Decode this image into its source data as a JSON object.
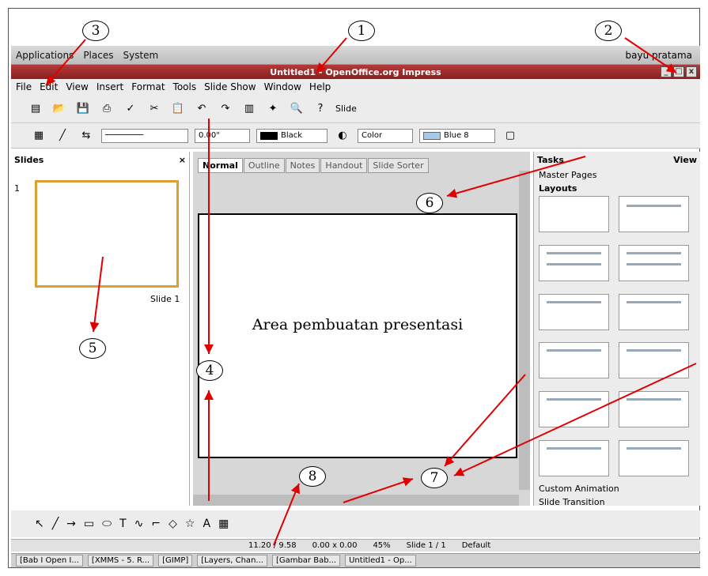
{
  "topbar": {
    "apps": "Applications",
    "places": "Places",
    "system": "System",
    "user": "bayu pratama"
  },
  "window": {
    "title": "Untitled1 - OpenOffice.org Impress"
  },
  "menu": [
    "File",
    "Edit",
    "View",
    "Insert",
    "Format",
    "Tools",
    "Slide Show",
    "Window",
    "Help"
  ],
  "toolbar2": {
    "linewidth": "0.00\"",
    "color": "Black",
    "fillmode": "Color",
    "fillcolor": "Blue 8"
  },
  "slides_panel": {
    "title": "Slides",
    "slide_num": "1",
    "slide_label": "Slide 1"
  },
  "editor": {
    "tabs": [
      "Normal",
      "Outline",
      "Notes",
      "Handout",
      "Slide Sorter"
    ],
    "slide_text": "Area pembuatan presentasi"
  },
  "tasks": {
    "title": "Tasks",
    "view": "View",
    "master": "Master Pages",
    "layouts": "Layouts",
    "animation": "Custom Animation",
    "transition": "Slide Transition"
  },
  "status": {
    "pos": "11.20 / 9.58",
    "size": "0.00 x 0.00",
    "zoom": "45%",
    "slide": "Slide 1 / 1",
    "style": "Default"
  },
  "taskbar": [
    "[Bab I Open I...",
    "[XMMS - 5. R...",
    "[GIMP]",
    "[Layers, Chan...",
    "[Gambar Bab...",
    "Untitled1 - Op..."
  ],
  "callouts": [
    "1",
    "2",
    "3",
    "4",
    "5",
    "6",
    "7",
    "8"
  ],
  "toolbar1_slide": "Slide"
}
